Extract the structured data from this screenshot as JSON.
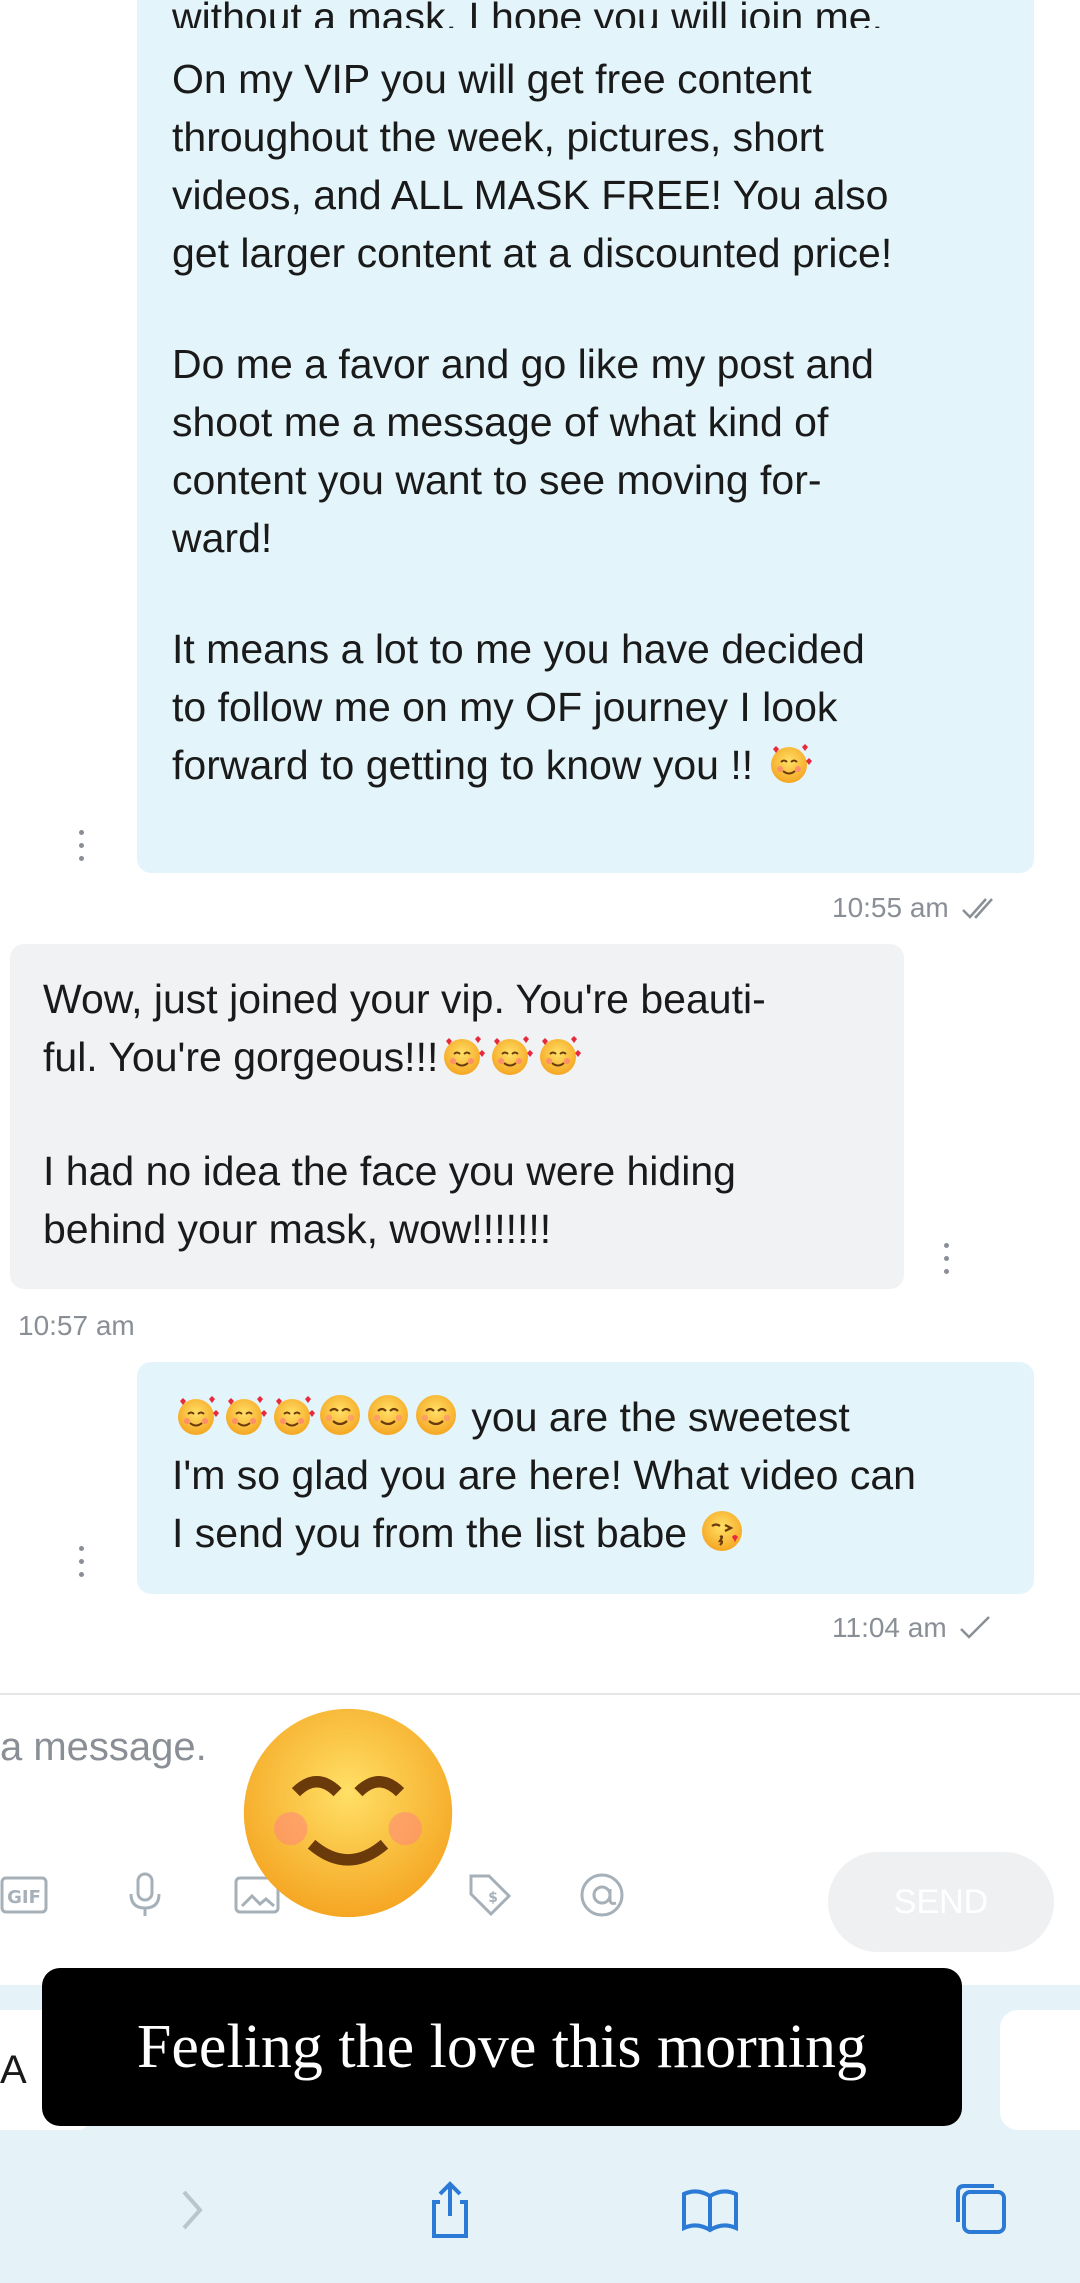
{
  "messages": {
    "m1": {
      "top_partial": "without a mask, I hope you will join me.",
      "p1": "On my VIP you will get free content\nthroughout the week, pictures, short\nvideos, and ALL MASK FREE! You also\nget larger content at a discounted price!",
      "p2": "Do me a favor and go like my post and\nshoot me a message of what kind of\ncontent you want to see moving for-\nward!",
      "p3": "It means a lot to me you have decided\nto follow me on my OF journey I look\nforward to getting to know you !!",
      "time": "10:55 am",
      "status_icon": "double-check-icon"
    },
    "m2": {
      "p1": "Wow, just joined your vip. You're beauti-\nful. You're gorgeous!!!",
      "p2": "I had no idea the face you were hiding\nbehind your mask, wow!!!!!!!",
      "time": "10:57 am"
    },
    "m3": {
      "p1_tail": " you are the sweetest",
      "p1_rest": "I'm so glad you are here! What video can\nI send you from the list babe",
      "time": "11:04 am",
      "status_icon": "check-icon"
    }
  },
  "composer": {
    "placeholder": "a message.",
    "send_label": "SEND",
    "tools": [
      "gif-icon",
      "microphone-icon",
      "media-icon",
      "price-tag-icon",
      "mention-icon"
    ]
  },
  "overlay": {
    "caption": "Feeling the love this morning",
    "sticker": "smiling-face-emoji"
  },
  "browser": {
    "field_text": "A",
    "nav": [
      "forward-icon",
      "share-icon",
      "bookmarks-icon",
      "tabs-icon"
    ]
  },
  "colors": {
    "outgoing_bubble": "#e3f5fb",
    "incoming_bubble": "#f1f2f4",
    "meta_text": "#8a8f96",
    "browser_bar": "#e5f3f9"
  }
}
